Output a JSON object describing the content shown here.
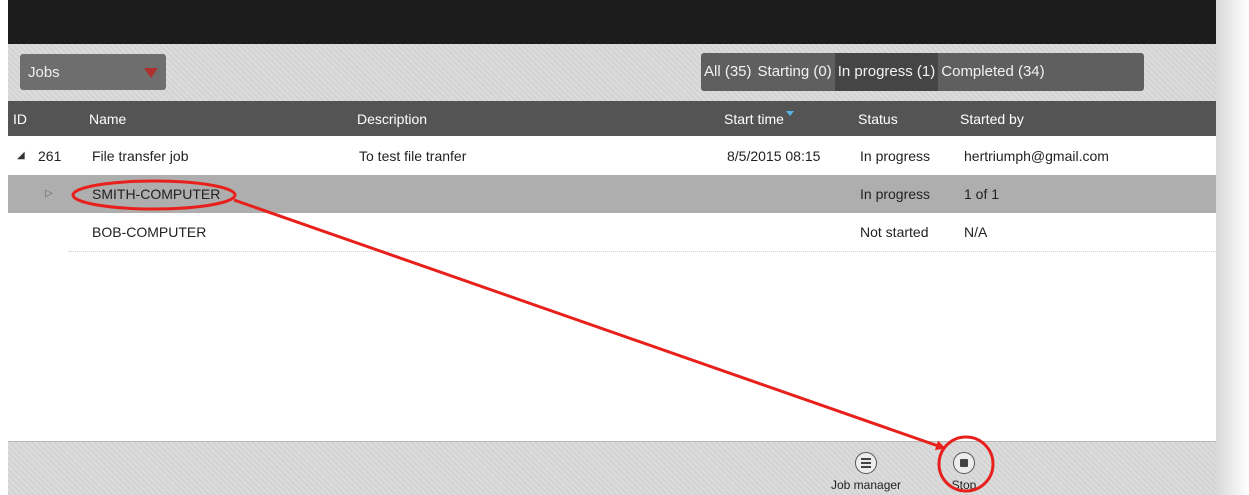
{
  "toolbar": {
    "jobs_dropdown": "Jobs",
    "filters": [
      "All (35)",
      "Starting (0)",
      "In progress (1)",
      "Completed (34)"
    ]
  },
  "columns": {
    "id": "ID",
    "name": "Name",
    "description": "Description",
    "start_time": "Start time",
    "status": "Status",
    "started_by": "Started by"
  },
  "rows": [
    {
      "expander": "◢",
      "id": "261",
      "name": "File transfer job",
      "description": "To test file tranfer",
      "start_time": "8/5/2015 08:15",
      "status": "In progress",
      "started_by": "hertriumph@gmail.com"
    },
    {
      "expander": "▷",
      "id": "",
      "name": "SMITH-COMPUTER",
      "description": "",
      "start_time": "",
      "status": "In progress",
      "started_by": "1 of 1"
    },
    {
      "expander": "",
      "id": "",
      "name": "BOB-COMPUTER",
      "description": "",
      "start_time": "",
      "status": "Not started",
      "started_by": "N/A"
    }
  ],
  "bottom_toolbar": {
    "job_manager": "Job manager",
    "stop": "Stop"
  },
  "annotation_color": "#e8201c"
}
